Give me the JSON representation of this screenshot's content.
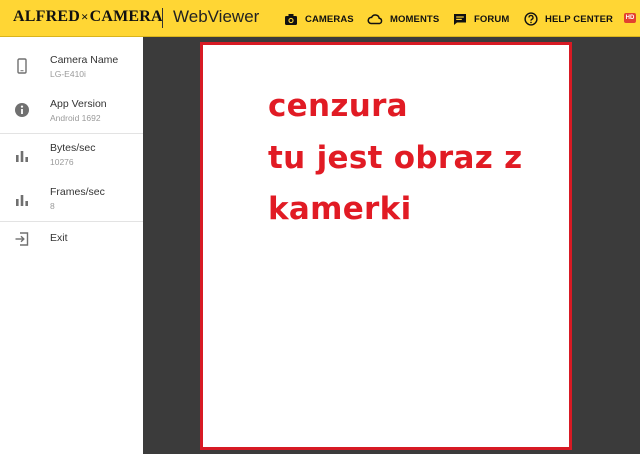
{
  "header": {
    "brand_first": "Alfred",
    "brand_sep": "×",
    "brand_second": "Camera",
    "product": "WebViewer",
    "nav": [
      {
        "label": "CAMERAS",
        "icon": "camera-icon"
      },
      {
        "label": "MOMENTS",
        "icon": "cloud-icon"
      },
      {
        "label": "FORUM",
        "icon": "forum-icon"
      },
      {
        "label": "HELP CENTER",
        "icon": "help-icon"
      }
    ],
    "lang_badge": "HD",
    "accent_color": "#ffd634"
  },
  "sidebar": {
    "items": [
      {
        "label": "Camera Name",
        "value": "LG-E410i",
        "icon": "phone-icon"
      },
      {
        "label": "App Version",
        "value": "Android 1692",
        "icon": "info-icon"
      },
      {
        "label": "Bytes/sec",
        "value": "10276",
        "icon": "bar-chart-icon"
      },
      {
        "label": "Frames/sec",
        "value": "8",
        "icon": "bar-chart-icon"
      },
      {
        "label": "Exit",
        "icon": "exit-icon"
      }
    ]
  },
  "viewer": {
    "overlay_lines": [
      "cenzura",
      "tu jest obraz z",
      "kamerki"
    ],
    "overlay_color": "#e11b24",
    "frame_border_color": "#d71a24"
  }
}
